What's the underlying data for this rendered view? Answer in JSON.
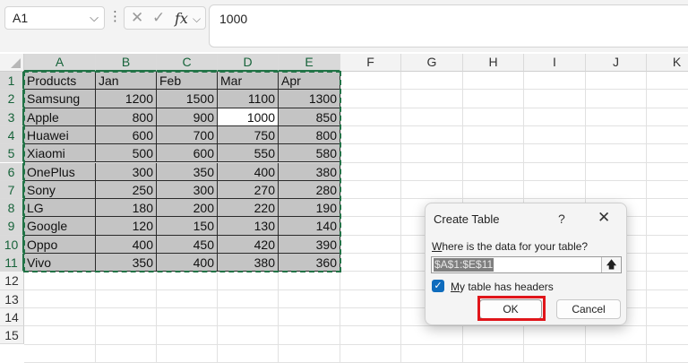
{
  "formula_bar": {
    "name_box": "A1",
    "fx_label": "fx",
    "cancel_glyph": "✕",
    "confirm_glyph": "✓",
    "formula_value": "1000"
  },
  "columns": [
    "A",
    "B",
    "C",
    "D",
    "E",
    "F",
    "G",
    "H",
    "I",
    "J",
    "K"
  ],
  "rows": [
    "1",
    "2",
    "3",
    "4",
    "5",
    "6",
    "7",
    "8",
    "9",
    "10",
    "11",
    "12",
    "13",
    "14",
    "15"
  ],
  "table": {
    "headers": [
      "Products",
      "Jan",
      "Feb",
      "Mar",
      "Apr"
    ],
    "data": [
      [
        "Samsung",
        "1200",
        "1500",
        "1100",
        "1300"
      ],
      [
        "Apple",
        "800",
        "900",
        "1000",
        "850"
      ],
      [
        "Huawei",
        "600",
        "700",
        "750",
        "800"
      ],
      [
        "Xiaomi",
        "500",
        "600",
        "550",
        "580"
      ],
      [
        "OnePlus",
        "300",
        "350",
        "400",
        "380"
      ],
      [
        "Sony",
        "250",
        "300",
        "270",
        "280"
      ],
      [
        "LG",
        "180",
        "200",
        "220",
        "190"
      ],
      [
        "Google",
        "120",
        "150",
        "130",
        "140"
      ],
      [
        "Oppo",
        "400",
        "450",
        "420",
        "390"
      ],
      [
        "Vivo",
        "350",
        "400",
        "380",
        "360"
      ]
    ]
  },
  "dialog": {
    "title": "Create Table",
    "help": "?",
    "close": "✕",
    "question_u": "W",
    "question_rest": "here is the data for your table?",
    "range_value": "$A$1:$E$11",
    "checkbox_checked": true,
    "checkbox_label_u": "M",
    "checkbox_label_rest": "y table has headers",
    "ok_label": "OK",
    "cancel_label": "Cancel"
  },
  "colors": {
    "accent": "#217346",
    "selection_fill": "#c4c4c4",
    "highlight": "#e0151a",
    "checkbox": "#0f6cbd"
  }
}
